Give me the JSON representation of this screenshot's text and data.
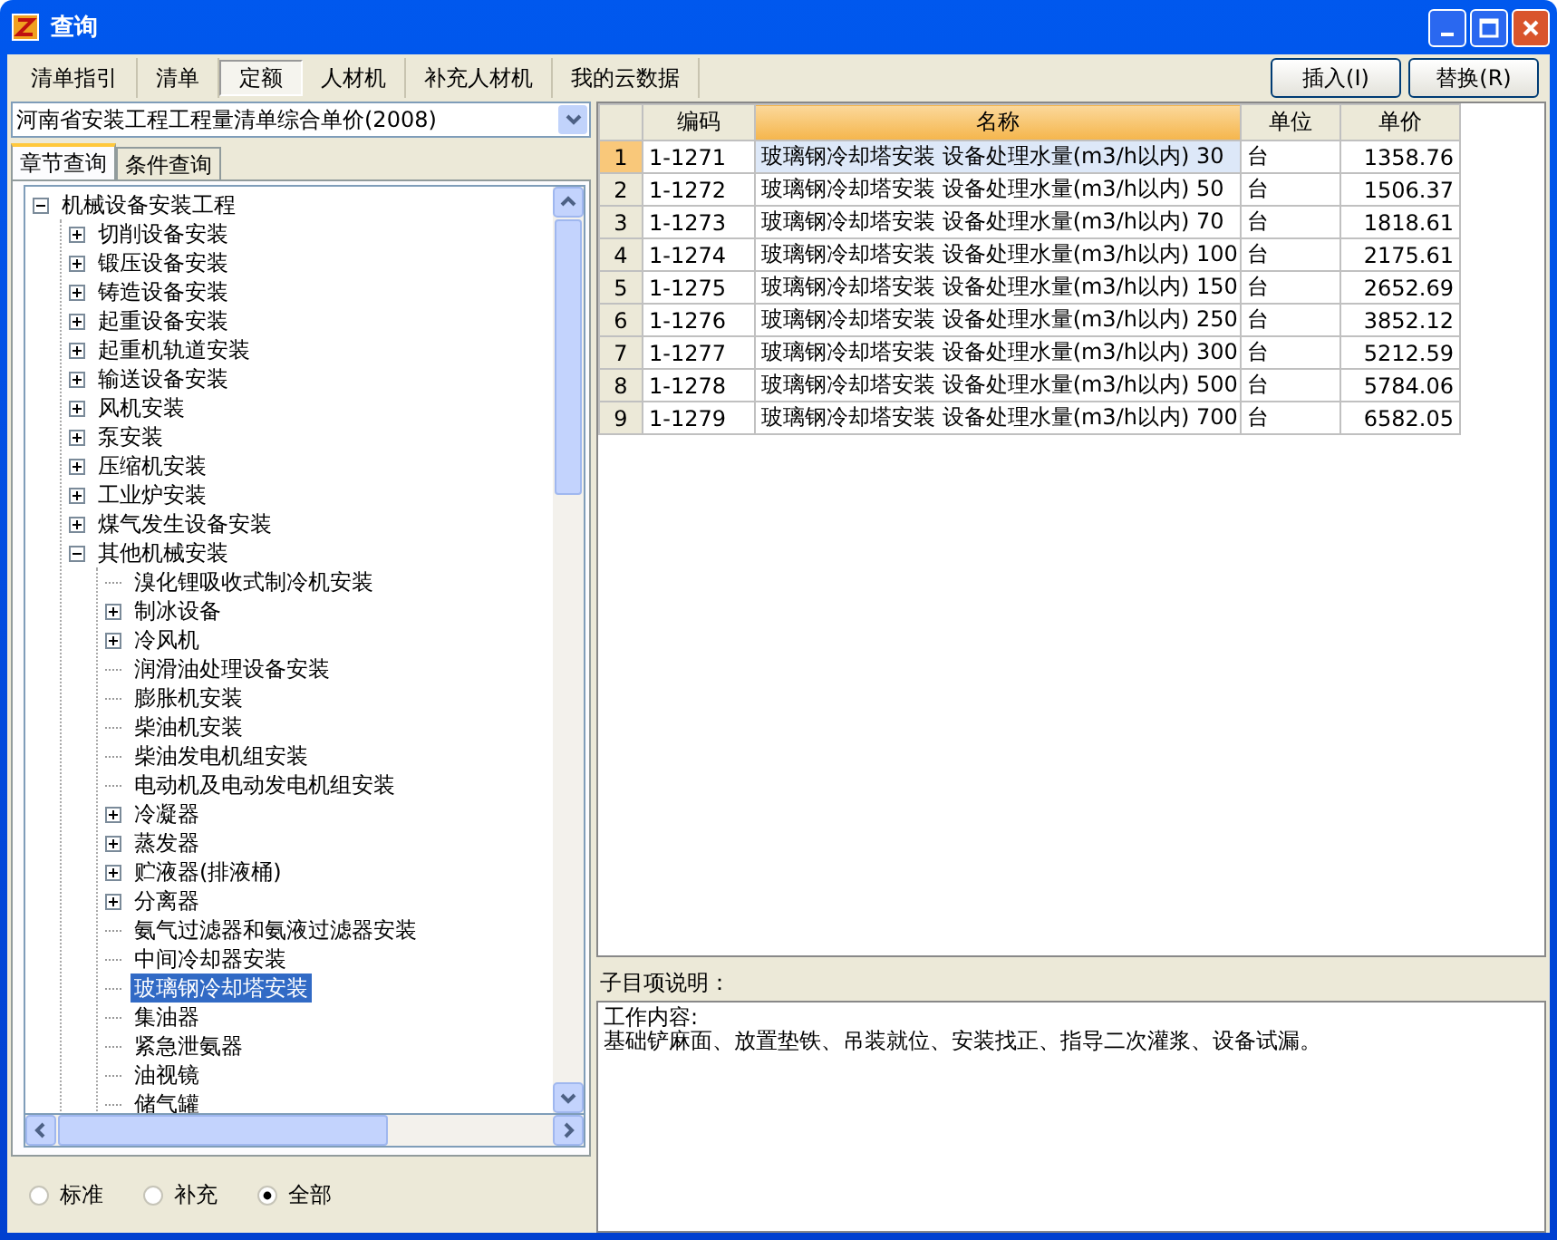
{
  "window": {
    "title": "查询"
  },
  "tabs": [
    {
      "label": "清单指引",
      "selected": false
    },
    {
      "label": "清单",
      "selected": false
    },
    {
      "label": "定额",
      "selected": true
    },
    {
      "label": "人材机",
      "selected": false
    },
    {
      "label": "补充人材机",
      "selected": false
    },
    {
      "label": "我的云数据",
      "selected": false
    }
  ],
  "buttons": [
    "插入(I)",
    "替换(R)"
  ],
  "library": {
    "value": "河南省安装工程工程量清单综合单价(2008)"
  },
  "query_tabs": [
    {
      "label": "章节查询",
      "selected": true
    },
    {
      "label": "条件查询",
      "selected": false
    }
  ],
  "tree": [
    {
      "label": "机械设备安装工程",
      "kind": "branch",
      "expanded": true,
      "selected": false,
      "children": [
        {
          "label": "切削设备安装",
          "kind": "branch",
          "expanded": false,
          "selected": false
        },
        {
          "label": "锻压设备安装",
          "kind": "branch",
          "expanded": false,
          "selected": false
        },
        {
          "label": "铸造设备安装",
          "kind": "branch",
          "expanded": false,
          "selected": false
        },
        {
          "label": "起重设备安装",
          "kind": "branch",
          "expanded": false,
          "selected": false
        },
        {
          "label": "起重机轨道安装",
          "kind": "branch",
          "expanded": false,
          "selected": false
        },
        {
          "label": "输送设备安装",
          "kind": "branch",
          "expanded": false,
          "selected": false
        },
        {
          "label": "风机安装",
          "kind": "branch",
          "expanded": false,
          "selected": false
        },
        {
          "label": "泵安装",
          "kind": "branch",
          "expanded": false,
          "selected": false
        },
        {
          "label": "压缩机安装",
          "kind": "branch",
          "expanded": false,
          "selected": false
        },
        {
          "label": "工业炉安装",
          "kind": "branch",
          "expanded": false,
          "selected": false
        },
        {
          "label": "煤气发生设备安装",
          "kind": "branch",
          "expanded": false,
          "selected": false
        },
        {
          "label": "其他机械安装",
          "kind": "branch",
          "expanded": true,
          "selected": false,
          "children": [
            {
              "label": "溴化锂吸收式制冷机安装",
              "kind": "leaf",
              "selected": false
            },
            {
              "label": "制冰设备",
              "kind": "branch",
              "expanded": false,
              "selected": false
            },
            {
              "label": "冷风机",
              "kind": "branch",
              "expanded": false,
              "selected": false
            },
            {
              "label": "润滑油处理设备安装",
              "kind": "leaf",
              "selected": false
            },
            {
              "label": "膨胀机安装",
              "kind": "leaf",
              "selected": false
            },
            {
              "label": "柴油机安装",
              "kind": "leaf",
              "selected": false
            },
            {
              "label": "柴油发电机组安装",
              "kind": "leaf",
              "selected": false
            },
            {
              "label": "电动机及电动发电机组安装",
              "kind": "leaf",
              "selected": false
            },
            {
              "label": "冷凝器",
              "kind": "branch",
              "expanded": false,
              "selected": false
            },
            {
              "label": "蒸发器",
              "kind": "branch",
              "expanded": false,
              "selected": false
            },
            {
              "label": "贮液器(排液桶)",
              "kind": "branch",
              "expanded": false,
              "selected": false
            },
            {
              "label": "分离器",
              "kind": "branch",
              "expanded": false,
              "selected": false
            },
            {
              "label": "氨气过滤器和氨液过滤器安装",
              "kind": "leaf",
              "selected": false
            },
            {
              "label": "中间冷却器安装",
              "kind": "leaf",
              "selected": false
            },
            {
              "label": "玻璃钢冷却塔安装",
              "kind": "leaf",
              "selected": true
            },
            {
              "label": "集油器",
              "kind": "leaf",
              "selected": false
            },
            {
              "label": "紧急泄氨器",
              "kind": "leaf",
              "selected": false
            },
            {
              "label": "油视镜",
              "kind": "leaf",
              "selected": false
            },
            {
              "label": "储气罐",
              "kind": "leaf",
              "selected": false
            }
          ]
        }
      ]
    }
  ],
  "filter": [
    {
      "label": "标准",
      "selected": false
    },
    {
      "label": "补充",
      "selected": false
    },
    {
      "label": "全部",
      "selected": true
    }
  ],
  "table": {
    "columns": [
      {
        "label": "编码",
        "selected": false
      },
      {
        "label": "名称",
        "selected": true
      },
      {
        "label": "单位",
        "selected": false
      },
      {
        "label": "单价",
        "selected": false
      }
    ],
    "rows": [
      {
        "number": "1",
        "code": "1-1271",
        "name": "玻璃钢冷却塔安装 设备处理水量(m3/h以内) 30",
        "unit": "台",
        "price": "1358.76",
        "selected": true
      },
      {
        "number": "2",
        "code": "1-1272",
        "name": "玻璃钢冷却塔安装 设备处理水量(m3/h以内) 50",
        "unit": "台",
        "price": "1506.37",
        "selected": false
      },
      {
        "number": "3",
        "code": "1-1273",
        "name": "玻璃钢冷却塔安装 设备处理水量(m3/h以内) 70",
        "unit": "台",
        "price": "1818.61",
        "selected": false
      },
      {
        "number": "4",
        "code": "1-1274",
        "name": "玻璃钢冷却塔安装 设备处理水量(m3/h以内) 100",
        "unit": "台",
        "price": "2175.61",
        "selected": false
      },
      {
        "number": "5",
        "code": "1-1275",
        "name": "玻璃钢冷却塔安装 设备处理水量(m3/h以内) 150",
        "unit": "台",
        "price": "2652.69",
        "selected": false
      },
      {
        "number": "6",
        "code": "1-1276",
        "name": "玻璃钢冷却塔安装 设备处理水量(m3/h以内) 250",
        "unit": "台",
        "price": "3852.12",
        "selected": false
      },
      {
        "number": "7",
        "code": "1-1277",
        "name": "玻璃钢冷却塔安装 设备处理水量(m3/h以内) 300",
        "unit": "台",
        "price": "5212.59",
        "selected": false
      },
      {
        "number": "8",
        "code": "1-1278",
        "name": "玻璃钢冷却塔安装 设备处理水量(m3/h以内) 500",
        "unit": "台",
        "price": "5784.06",
        "selected": false
      },
      {
        "number": "9",
        "code": "1-1279",
        "name": "玻璃钢冷却塔安装 设备处理水量(m3/h以内) 700",
        "unit": "台",
        "price": "6582.05",
        "selected": false
      }
    ]
  },
  "description": {
    "label": "子目项说明：",
    "lines": [
      "工作内容:",
      "基础铲麻面、放置垫铁、吊装就位、安装找正、指导二次灌浆、设备试漏。"
    ]
  }
}
